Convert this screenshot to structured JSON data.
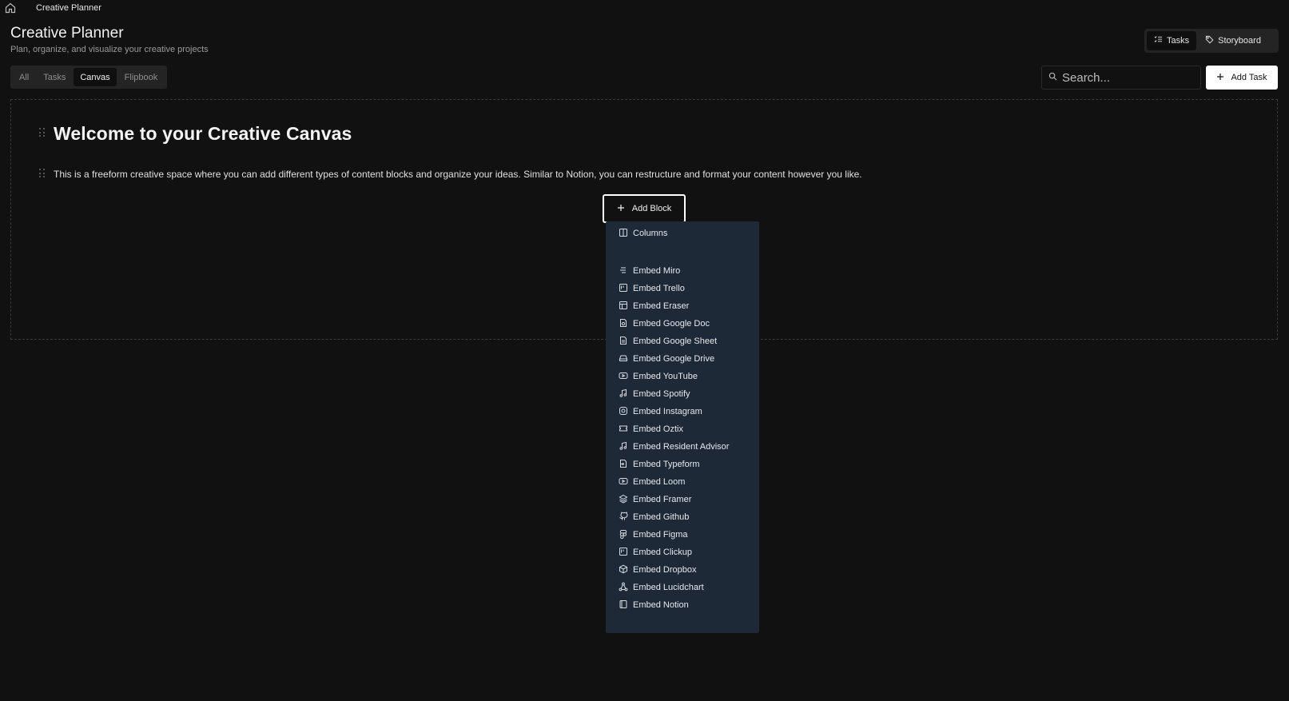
{
  "topbar": {
    "title": "Creative Planner"
  },
  "header": {
    "title": "Creative Planner",
    "subtitle": "Plan, organize, and visualize your creative projects",
    "view_toggle": {
      "tasks_label": "Tasks",
      "storyboard_label": "Storyboard",
      "active": "Tasks"
    }
  },
  "tabs": {
    "items": [
      {
        "label": "All"
      },
      {
        "label": "Tasks"
      },
      {
        "label": "Canvas"
      },
      {
        "label": "Flipbook"
      }
    ],
    "active": "Canvas"
  },
  "search": {
    "placeholder": "Search..."
  },
  "add_task": {
    "label": "Add Task"
  },
  "canvas": {
    "heading": "Welcome to your Creative Canvas",
    "paragraph": "This is a freeform creative space where you can add different types of content blocks and organize your ideas. Similar to Notion, you can restructure and format your content however you like.",
    "add_block_label": "Add Block"
  },
  "block_menu": {
    "items": [
      {
        "label": "Columns",
        "icon": "columns-icon"
      },
      {
        "label": "Embed Miro",
        "icon": "miro-icon"
      },
      {
        "label": "Embed Trello",
        "icon": "trello-icon"
      },
      {
        "label": "Embed Eraser",
        "icon": "eraser-icon"
      },
      {
        "label": "Embed Google Doc",
        "icon": "google-doc-icon"
      },
      {
        "label": "Embed Google Sheet",
        "icon": "google-sheet-icon"
      },
      {
        "label": "Embed Google Drive",
        "icon": "google-drive-icon"
      },
      {
        "label": "Embed YouTube",
        "icon": "youtube-icon"
      },
      {
        "label": "Embed Spotify",
        "icon": "music-icon"
      },
      {
        "label": "Embed Instagram",
        "icon": "instagram-icon"
      },
      {
        "label": "Embed Oztix",
        "icon": "ticket-icon"
      },
      {
        "label": "Embed Resident Advisor",
        "icon": "music-icon"
      },
      {
        "label": "Embed Typeform",
        "icon": "form-icon"
      },
      {
        "label": "Embed Loom",
        "icon": "video-icon"
      },
      {
        "label": "Embed Framer",
        "icon": "layers-icon"
      },
      {
        "label": "Embed Github",
        "icon": "github-icon"
      },
      {
        "label": "Embed Figma",
        "icon": "figma-icon"
      },
      {
        "label": "Embed Clickup",
        "icon": "clickup-icon"
      },
      {
        "label": "Embed Dropbox",
        "icon": "box-icon"
      },
      {
        "label": "Embed Lucidchart",
        "icon": "network-icon"
      },
      {
        "label": "Embed Notion",
        "icon": "notion-icon"
      }
    ]
  },
  "colors": {
    "background": "#111111",
    "menu_background": "#1e2937",
    "accent": "#ffffff"
  }
}
